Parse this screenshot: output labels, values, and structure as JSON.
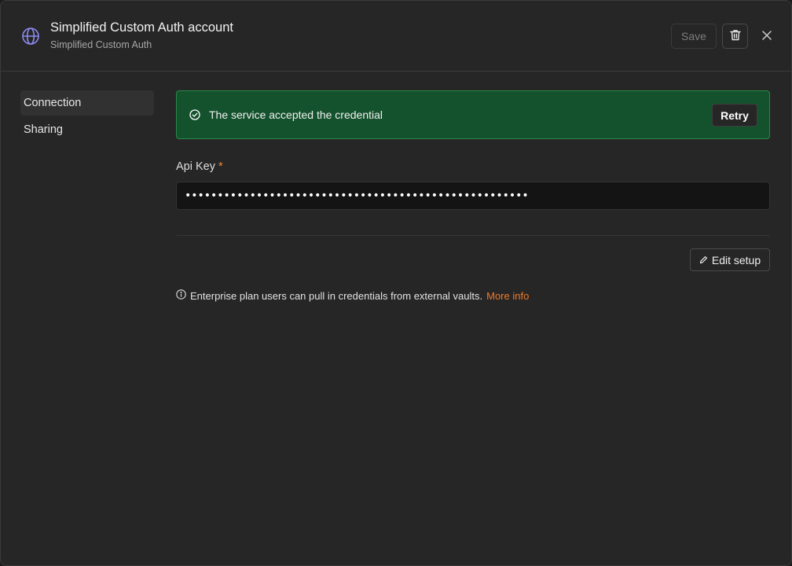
{
  "header": {
    "title": "Simplified Custom Auth account",
    "subtitle": "Simplified Custom Auth",
    "save_label": "Save",
    "icon": "globe-icon",
    "accent_color": "#8b8bf0"
  },
  "sidebar": {
    "items": [
      {
        "label": "Connection",
        "active": true
      },
      {
        "label": "Sharing",
        "active": false
      }
    ]
  },
  "banner": {
    "text": "The service accepted the credential",
    "retry_label": "Retry",
    "color": "#14522d"
  },
  "api_key": {
    "label": "Api Key",
    "required_mark": "*",
    "value": "•••••••••••••••••••••••••••••••••••••••••••••••••••••"
  },
  "edit_setup_label": "Edit setup",
  "info": {
    "text": "Enterprise plan users can pull in credentials from external vaults.",
    "link_text": "More info",
    "link_color": "#f07a2a"
  }
}
